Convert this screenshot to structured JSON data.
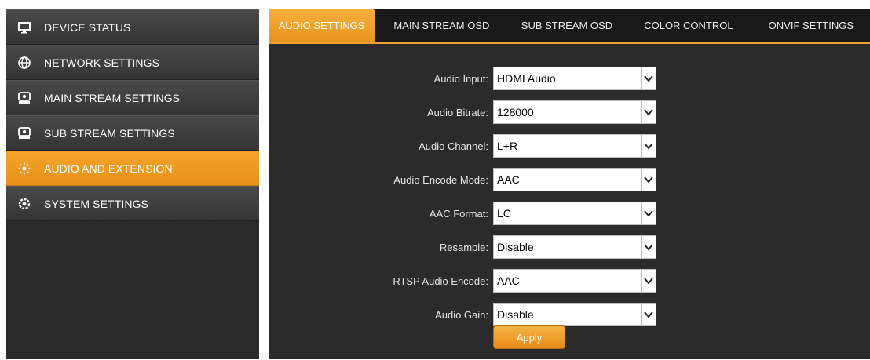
{
  "sidebar": {
    "items": [
      {
        "label": "DEVICE STATUS",
        "icon": "monitor-icon",
        "active": false
      },
      {
        "label": "NETWORK SETTINGS",
        "icon": "globe-icon",
        "active": false
      },
      {
        "label": "MAIN STREAM SETTINGS",
        "icon": "camera-icon",
        "active": false
      },
      {
        "label": "SUB STREAM SETTINGS",
        "icon": "camera-icon",
        "active": false
      },
      {
        "label": "AUDIO AND EXTENSION",
        "icon": "audio-icon",
        "active": true
      },
      {
        "label": "SYSTEM SETTINGS",
        "icon": "gear-icon",
        "active": false
      }
    ]
  },
  "tabs": [
    {
      "label": "AUDIO SETTINGS",
      "active": true
    },
    {
      "label": "MAIN STREAM OSD",
      "active": false
    },
    {
      "label": "SUB STREAM OSD",
      "active": false
    },
    {
      "label": "COLOR CONTROL",
      "active": false
    },
    {
      "label": "ONVIF SETTINGS",
      "active": false
    }
  ],
  "form": {
    "fields": [
      {
        "label": "Audio Input:",
        "value": "HDMI Audio"
      },
      {
        "label": "Audio Bitrate:",
        "value": "128000"
      },
      {
        "label": "Audio Channel:",
        "value": "L+R"
      },
      {
        "label": "Audio Encode Mode:",
        "value": "AAC"
      },
      {
        "label": "AAC Format:",
        "value": "LC"
      },
      {
        "label": "Resample:",
        "value": "Disable"
      },
      {
        "label": "RTSP Audio Encode:",
        "value": "AAC"
      },
      {
        "label": "Audio Gain:",
        "value": "Disable"
      }
    ],
    "apply_label": "Apply"
  },
  "colors": {
    "accent": "#f0a030",
    "sidebar_bg": "#2a2a2a",
    "main_bg": "#2b2b2b"
  }
}
